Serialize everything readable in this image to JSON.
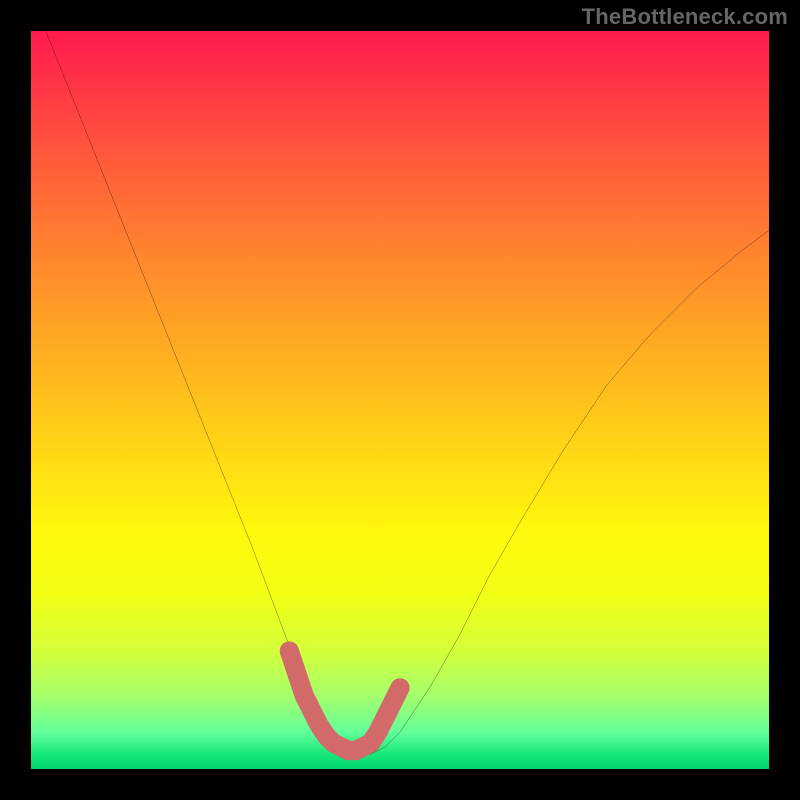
{
  "watermark": "TheBottleneck.com",
  "chart_data": {
    "type": "line",
    "title": "",
    "xlabel": "",
    "ylabel": "",
    "xlim": [
      0,
      100
    ],
    "ylim": [
      0,
      100
    ],
    "grid": false,
    "legend": false,
    "series": [
      {
        "name": "bottleneck-curve",
        "x": [
          2,
          6,
          10,
          14,
          18,
          22,
          26,
          30,
          33,
          36,
          38,
          40,
          42,
          44,
          46,
          48,
          50,
          54,
          58,
          62,
          66,
          72,
          78,
          84,
          90,
          96,
          100
        ],
        "values": [
          100,
          90,
          80,
          70,
          60,
          50,
          40,
          30,
          22,
          14,
          9,
          5,
          3,
          2,
          2,
          3,
          5,
          11,
          18,
          26,
          33,
          43,
          52,
          59,
          65,
          70,
          73
        ]
      },
      {
        "name": "bottleneck-highlight",
        "x": [
          35,
          36,
          37,
          38,
          39,
          40,
          41,
          42,
          43,
          44,
          45,
          46,
          47,
          48,
          49,
          50
        ],
        "values": [
          16,
          13,
          10,
          8,
          6,
          4.5,
          3.5,
          3,
          2.5,
          2.5,
          3,
          3.5,
          5,
          7,
          9,
          11
        ]
      }
    ],
    "colors": {
      "curve": "#000000",
      "highlight": "#d26a6a"
    },
    "gradient_stops": [
      {
        "pos": 0,
        "color": "#ff1a4f"
      },
      {
        "pos": 50,
        "color": "#ffda14"
      },
      {
        "pos": 80,
        "color": "#d4ff3a"
      },
      {
        "pos": 100,
        "color": "#00d469"
      }
    ]
  }
}
